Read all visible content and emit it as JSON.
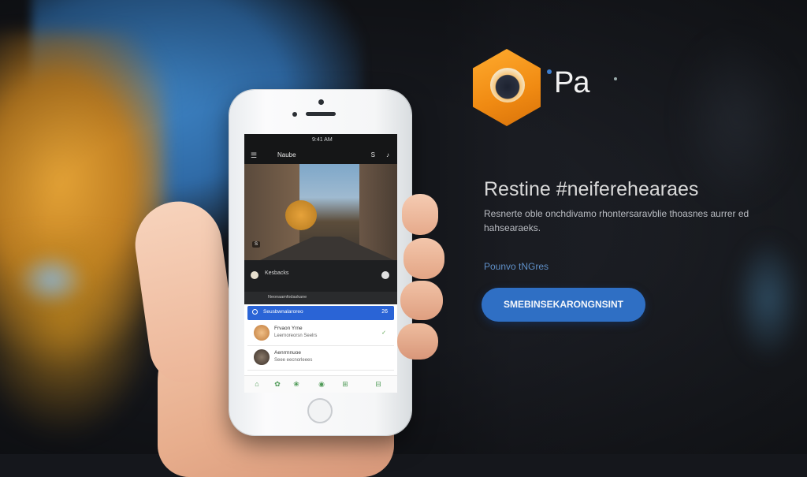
{
  "phone": {
    "status_time": "9:41 AM",
    "app_title": "Naube",
    "hero_badge": "S",
    "section_label": "Kesbacks",
    "sub_label": "Neonaamfodaskane",
    "search_text": "Seusbwnalaroreo",
    "search_date": "26",
    "items": [
      {
        "name": "Frvaon Yrne",
        "meta": "Leernoreorsn Seelrs",
        "status": "✓"
      },
      {
        "name": "Aenrrnnuoe",
        "meta": "Seee eecnorleees",
        "status": ""
      }
    ]
  },
  "brand": {
    "name": "Pa"
  },
  "hero_copy": {
    "headline": "Restine #neiferehearaes",
    "description": "Resnerte oble onchdivamo rhontersaravblie thoasnes aurrer ed hahsearaeks.",
    "link": "Pounvo tNGres",
    "cta": "SMEBINSEKARONGNSINT"
  },
  "colors": {
    "accent": "#2f6fc4",
    "logo_orange": "#f08a12",
    "search_blue": "#2a64d6"
  }
}
